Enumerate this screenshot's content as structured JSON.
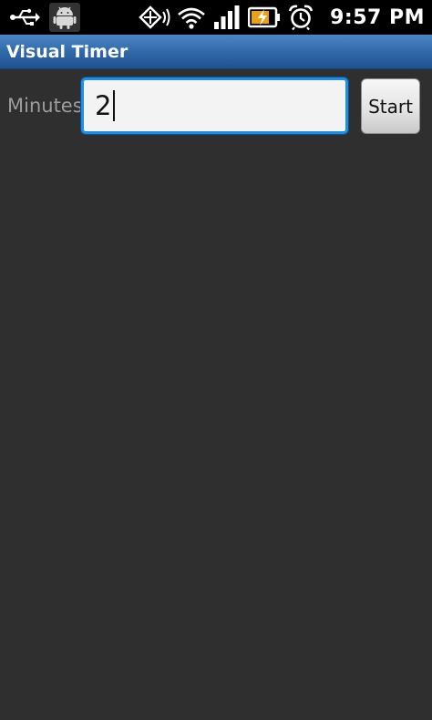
{
  "status_bar": {
    "time": "9:57 PM",
    "icons": [
      "usb-icon",
      "android-debug-icon",
      "location-icon",
      "wifi-icon",
      "signal-icon",
      "battery-charging-icon",
      "alarm-icon"
    ]
  },
  "title_bar": {
    "title": "Visual Timer"
  },
  "form": {
    "minutes_label": "Minutes",
    "minutes_value": "2",
    "start_label": "Start"
  },
  "colors": {
    "background": "#2f2f2f",
    "title_bar": "#2f67a6",
    "focus_border": "#1b8fe6"
  }
}
